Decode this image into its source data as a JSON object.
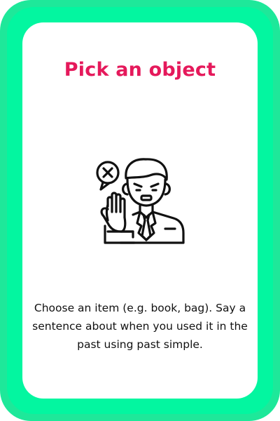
{
  "card": {
    "title": "Pick an object",
    "illustration_icon": "man-stop-gesture-icon",
    "instructions": "Choose an item (e.g. book, bag). Say a sentence about when you used it in the past using past simple."
  },
  "colors": {
    "border": "#1EE89A",
    "border_highlight": "#03F6A0",
    "title": "#E5195B",
    "text": "#111111",
    "background": "#FFFFFF"
  }
}
